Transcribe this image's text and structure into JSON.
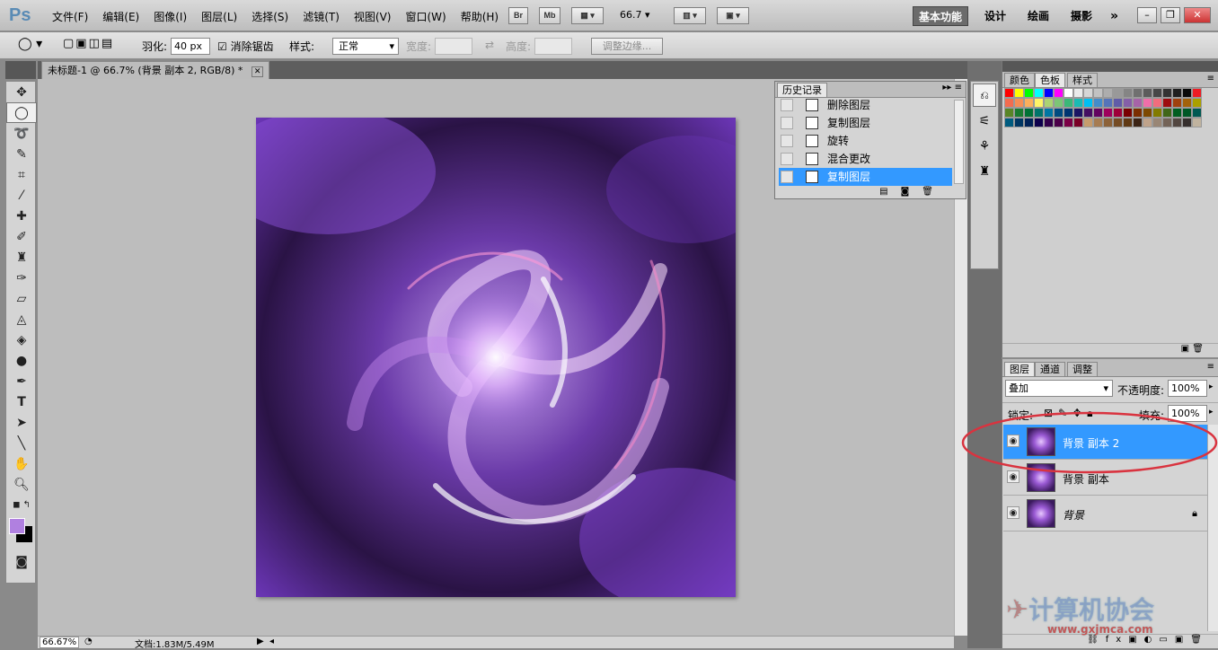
{
  "app": {
    "logo": "Ps"
  },
  "menu": [
    "文件(F)",
    "编辑(E)",
    "图像(I)",
    "图层(L)",
    "选择(S)",
    "滤镜(T)",
    "视图(V)",
    "窗口(W)",
    "帮助(H)"
  ],
  "app_bar": {
    "bridge_label": "Br",
    "minibridge_label": "Mb",
    "zoom_value": "66.7"
  },
  "workspaces": [
    "基本功能",
    "设计",
    "绘画",
    "摄影"
  ],
  "workspace_more": "»",
  "options": {
    "feather_label": "羽化:",
    "feather_value": "40 px",
    "antialias_label": "消除锯齿",
    "antialias_checked": true,
    "style_label": "样式:",
    "style_value": "正常",
    "width_label": "宽度:",
    "height_label": "高度:",
    "refine_edge_label": "调整边缘..."
  },
  "document": {
    "tab_title": "未标题-1 @ 66.7% (背景 副本 2, RGB/8) *",
    "zoom_status": "66.67%",
    "doc_size": "文档:1.83M/5.49M"
  },
  "history": {
    "tab_label": "历史记录",
    "items": [
      {
        "label": "删除图层",
        "selected": false
      },
      {
        "label": "复制图层",
        "selected": false
      },
      {
        "label": "旋转",
        "selected": false
      },
      {
        "label": "混合更改",
        "selected": false
      },
      {
        "label": "复制图层",
        "selected": true
      }
    ]
  },
  "swatch_tabs": [
    "颜色",
    "色板",
    "样式"
  ],
  "swatch_colors": [
    "#ff0000",
    "#ffff00",
    "#00ff00",
    "#00ffff",
    "#0000ff",
    "#ff00ff",
    "#ffffff",
    "#ebebeb",
    "#d6d6d6",
    "#c2c2c2",
    "#adadad",
    "#999999",
    "#858585",
    "#707070",
    "#5c5c5c",
    "#474747",
    "#333333",
    "#1f1f1f",
    "#0a0a0a",
    "#ed1c24",
    "#f26c4f",
    "#f68e55",
    "#fbaf5c",
    "#fff467",
    "#acd372",
    "#7cc576",
    "#3bb878",
    "#1abbb4",
    "#00bff3",
    "#438cca",
    "#5574b9",
    "#605ca8",
    "#855fa8",
    "#a763a8",
    "#f06ea9",
    "#f26d7d",
    "#9e0b0f",
    "#a0410d",
    "#a3620a",
    "#aba000",
    "#598527",
    "#1a7b30",
    "#007236",
    "#00746b",
    "#0076a3",
    "#004b80",
    "#003471",
    "#1b1464",
    "#440e62",
    "#630460",
    "#9e005d",
    "#9e0039",
    "#790000",
    "#7b2e00",
    "#7d4900",
    "#827b00",
    "#406618",
    "#005e20",
    "#005826",
    "#005952",
    "#005b7f",
    "#003663",
    "#002157",
    "#0d004c",
    "#32004b",
    "#4b0049",
    "#7b0046",
    "#7a0026",
    "#c69c6d",
    "#a67c52",
    "#8c6239",
    "#754c24",
    "#603913",
    "#3c2415",
    "#bfa38b",
    "#998675",
    "#736357",
    "#534741",
    "#362f2d",
    "#c0b39f"
  ],
  "layers": {
    "tabs": [
      "图层",
      "通道",
      "调整"
    ],
    "blend_mode": "叠加",
    "opacity_label": "不透明度:",
    "opacity_value": "100%",
    "lock_label": "锁定:",
    "fill_label": "填充:",
    "fill_value": "100%",
    "items": [
      {
        "name": "背景 副本 2",
        "selected": true,
        "locked": false
      },
      {
        "name": "背景 副本",
        "selected": false,
        "locked": false
      },
      {
        "name": "背景",
        "selected": false,
        "locked": true
      }
    ]
  },
  "watermark": {
    "text": "计算机协会",
    "url": "www.gxjmca.com"
  },
  "colors": {
    "foreground": "#b080e0",
    "background": "#000000",
    "selection": "#3399ff",
    "highlight_ring": "#d9333f"
  }
}
